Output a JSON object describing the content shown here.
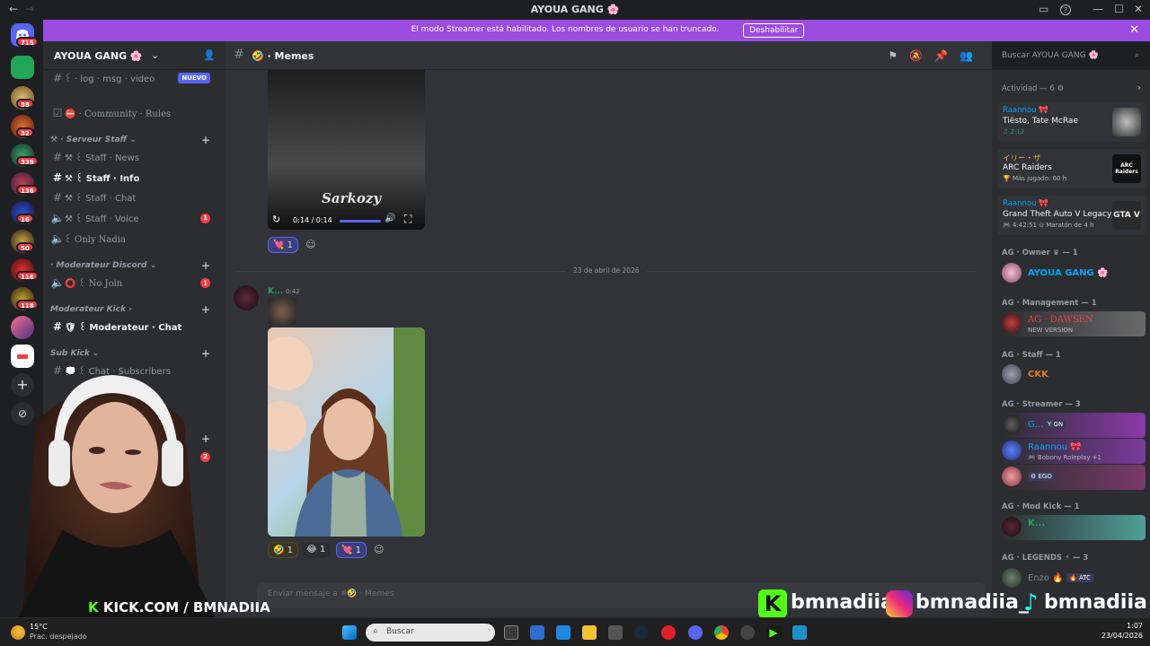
{
  "window": {
    "title": "AYOUA GANG 🌸",
    "back_glyph": "←",
    "fwd_glyph": "→",
    "min_glyph": "—",
    "max_glyph": "☐",
    "close_glyph": "✕",
    "inbox_glyph": "▭",
    "help_glyph": "?"
  },
  "banner": {
    "text": "El modo Streamer está habilitado. Los nombres de usuario se han truncado.",
    "button": "Deshabilitar",
    "close": "✕"
  },
  "rail": {
    "home_badge": "715",
    "badges": [
      "38",
      "32",
      "339",
      "136",
      "16",
      "50",
      "116",
      "118"
    ],
    "add": "+",
    "explore": "⊘"
  },
  "sidebar": {
    "guild_name": "AYOUA GANG 🌸",
    "top_channel": "꒰ · log · msg · video",
    "top_badge": "NUEVO",
    "rules": "⛔ · Community · Rules",
    "cat1": "⚒ · Serveur Staff ⌄",
    "ch_news": "⚒ ꒰ Staff · News",
    "ch_info": "⚒ ꒰ Staff · Info",
    "ch_chat": "⚒ ꒰ Staff · Chat",
    "ch_voice": "⚒ ꒰ Staff · Voice",
    "ch_voice_badge": "1",
    "ch_nadia": "꒰ Only Nadia",
    "cat2": "· Moderateur Discord ⌄",
    "ch_nojoin": "⭕ ꒰ No Join",
    "ch_nojoin_badge": "1",
    "cat3": "Moderateur Kick ›",
    "ch_modchat": "🛡 ꒰ Moderateur · Chat",
    "cat4": "Sub Kick ⌄",
    "ch_subs": "💭 ꒰ Chat · Subscribers",
    "extra_badge": "2",
    "plus": "+"
  },
  "header": {
    "channel": "🤣 · Memes"
  },
  "search": {
    "placeholder": "Buscar AYOUA GANG 🌸"
  },
  "chat": {
    "video_time": "0:14 / 0:14",
    "video_caption": "Sarkozy",
    "react1": "💘 1",
    "date_divider": "23 de abril de 2026",
    "msg_author": "K...",
    "msg_time": "0:42",
    "reacts2": [
      "🤣 1",
      "😂 1",
      "💘 1"
    ],
    "input_placeholder": "Enviar mensaje a #🤣 · Memes"
  },
  "members": {
    "activity_header": "Actividad — 6 ⚙",
    "activity": [
      {
        "user": "Raannou 🎀",
        "title": "Tiësto, Tate McRae",
        "sub": "♫ 2:12"
      },
      {
        "user": "イリー・ザ",
        "title": "ARC Raiders",
        "sub": "🏆 Más jugado: 60 h"
      },
      {
        "user": "Raannou 🎀",
        "title": "Grand Theft Auto V Legacy",
        "sub": "🎮 4:42:51 ⊙ Maratón de 4 h"
      }
    ],
    "arc_logo": "ARC Raiders",
    "gta_logo": "GTA V",
    "cat_owner": "AG · Owner ♛ — 1",
    "owner_name": "AYOUA GANG 🌸",
    "cat_mgmt": "AG · Management — 1",
    "mgmt_name": "AG · DAWSEN",
    "mgmt_sub": "NEW VERSION",
    "cat_staff": "AG · Staff — 1",
    "staff_name": "CKK",
    "cat_streamer": "AG · Streamer — 3",
    "streamer1": "G...",
    "streamer1_tag": "Y GN",
    "streamer2": "Raannou 🎀",
    "streamer2_sub": "🎮 Bobony Roleplay +1",
    "streamer3_tag": "⚙ EGO",
    "cat_modkick": "AG · Mod Kick — 1",
    "modkick_name": "K...",
    "cat_legends": "AG · LEGENDS ⚡ — 3",
    "legend_name": "Enzo 🔥",
    "legend_tag": "🔥 ATC"
  },
  "taskbar": {
    "weather_temp": "15°C",
    "weather_desc": "Prac. despejado",
    "search": "Buscar",
    "time": "1:07",
    "date": "23/04/2026"
  },
  "overlay": {
    "kick": "KICK.COM / BMNADIIA",
    "social1": "bmnadiia",
    "social2": "bmnadiia_",
    "social3": "bmnadiia"
  },
  "colors": {
    "blurple": "#5865f2",
    "banner": "#9b4be0",
    "red": "#f23f43",
    "kick_green": "#53fc18"
  }
}
